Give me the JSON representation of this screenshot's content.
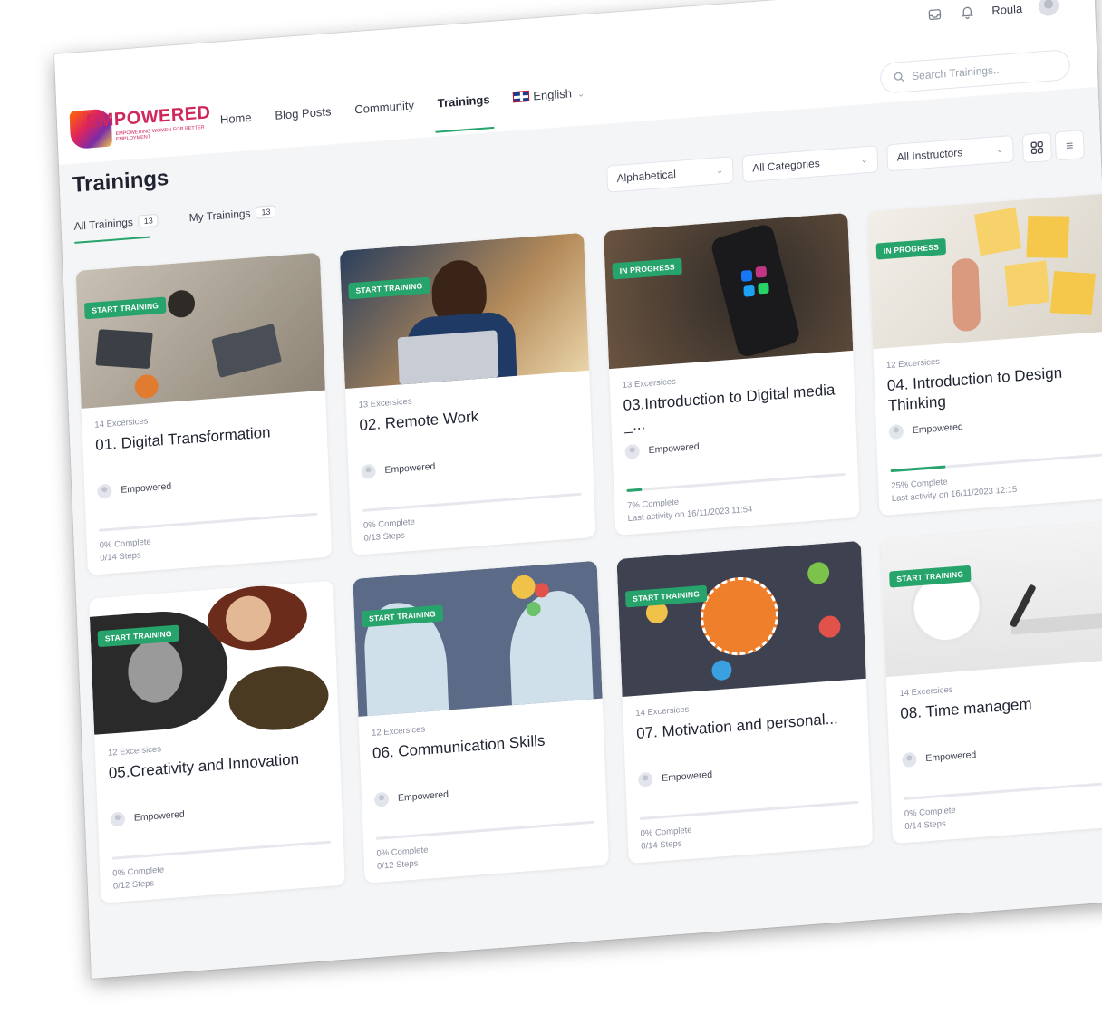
{
  "brand": {
    "name": "EMPOWERED",
    "tagline": "EMPOWERING WOMEN FOR BETTER EMPLOYMENT"
  },
  "nav": [
    {
      "label": "Home",
      "active": false
    },
    {
      "label": "Blog Posts",
      "active": false
    },
    {
      "label": "Community",
      "active": false
    },
    {
      "label": "Trainings",
      "active": true
    }
  ],
  "language": {
    "label": "English"
  },
  "user": {
    "name": "Roula"
  },
  "search": {
    "placeholder": "Search Trainings..."
  },
  "page": {
    "title": "Trainings"
  },
  "tabs": [
    {
      "label": "All Trainings",
      "count": "13",
      "active": true
    },
    {
      "label": "My Trainings",
      "count": "13",
      "active": false
    }
  ],
  "filters": {
    "sort": "Alphabetical",
    "category": "All Categories",
    "instructor": "All Instructors"
  },
  "accent_color": "#27a36c",
  "cards": [
    {
      "badge": "START TRAINING",
      "exercises": "14 Excersices",
      "title": "01. Digital Transformation",
      "author": "Empowered",
      "progress": 0,
      "complete": "0% Complete",
      "steps": "0/14 Steps"
    },
    {
      "badge": "START TRAINING",
      "exercises": "13 Excersices",
      "title": "02. Remote Work",
      "author": "Empowered",
      "progress": 0,
      "complete": "0% Complete",
      "steps": "0/13 Steps"
    },
    {
      "badge": "IN PROGRESS",
      "exercises": "13 Excersices",
      "title": "03.Introduction to Digital media _...",
      "author": "Empowered",
      "progress": 7,
      "complete": "7% Complete",
      "steps": "Last activity on 16/11/2023 11:54"
    },
    {
      "badge": "IN PROGRESS",
      "exercises": "12 Excersices",
      "title": "04. Introduction to Design Thinking",
      "author": "Empowered",
      "progress": 25,
      "complete": "25% Complete",
      "steps": "Last activity on 16/11/2023 12:15"
    },
    {
      "badge": "START TRAINING",
      "exercises": "12 Excersices",
      "title": "05.Creativity and Innovation",
      "author": "Empowered",
      "progress": 0,
      "complete": "0% Complete",
      "steps": "0/12 Steps"
    },
    {
      "badge": "START TRAINING",
      "exercises": "12 Excersices",
      "title": "06. Communication Skills",
      "author": "Empowered",
      "progress": 0,
      "complete": "0% Complete",
      "steps": "0/12 Steps"
    },
    {
      "badge": "START TRAINING",
      "exercises": "14 Excersices",
      "title": "07. Motivation and personal...",
      "author": "Empowered",
      "progress": 0,
      "complete": "0% Complete",
      "steps": "0/14 Steps"
    },
    {
      "badge": "START TRAINING",
      "exercises": "14 Excersices",
      "title": "08. Time managem",
      "author": "Empowered",
      "progress": 0,
      "complete": "0% Complete",
      "steps": "0/14 Steps"
    }
  ]
}
